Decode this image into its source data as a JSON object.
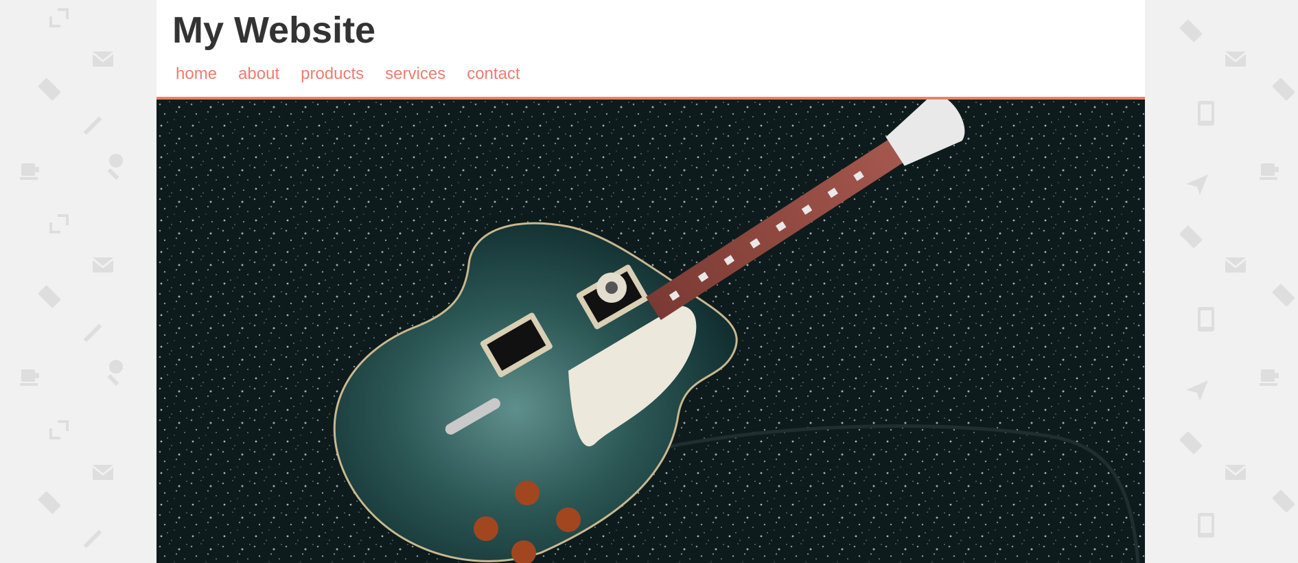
{
  "site": {
    "title": "My Website"
  },
  "nav": {
    "items": [
      {
        "label": "home"
      },
      {
        "label": "about"
      },
      {
        "label": "products"
      },
      {
        "label": "services"
      },
      {
        "label": "contact"
      }
    ]
  },
  "hero": {
    "subject": "electric guitar on dark textured surface"
  },
  "background": {
    "pattern_icons": [
      "expand-icon",
      "mail-icon",
      "tag-icon",
      "pencil-icon",
      "coffee-cup-icon",
      "wrench-icon",
      "tablet-icon",
      "send-icon"
    ]
  },
  "colors": {
    "accent": "#ee7d6d",
    "title": "#333333",
    "page_background": "#f1f1f1"
  }
}
